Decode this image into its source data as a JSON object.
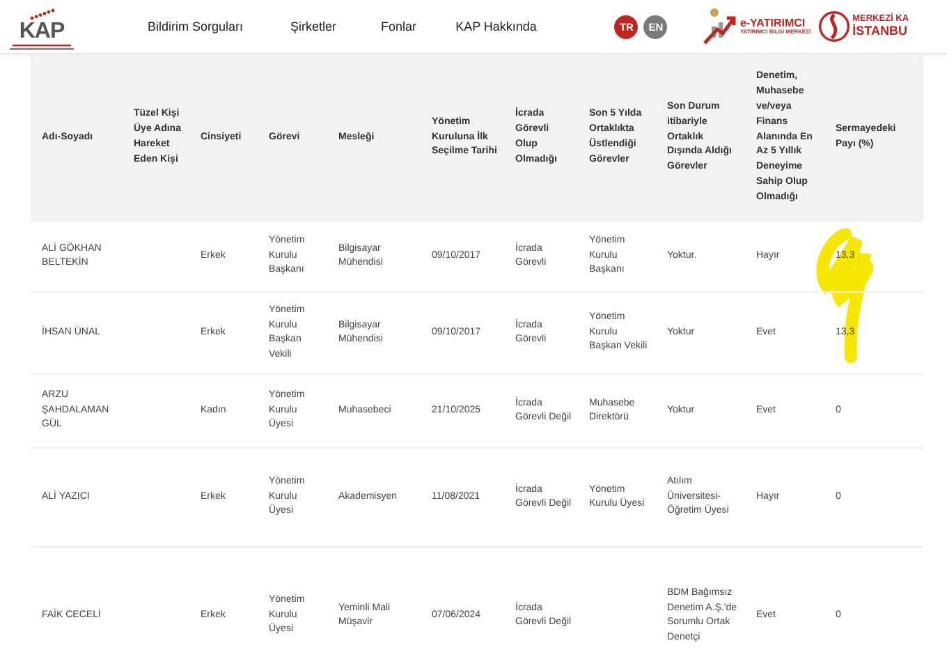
{
  "header": {
    "logo": {
      "text": "KAP"
    },
    "nav": [
      "Bildirim Sorguları",
      "Şirketler",
      "Fonlar",
      "KAP Hakkında"
    ],
    "languages": [
      {
        "label": "TR",
        "selected": true
      },
      {
        "label": "EN",
        "selected": false
      }
    ],
    "partners": [
      {
        "kind": "eyatirimci",
        "title": "e-YATIRIMCI",
        "subtitle": "YATIRIMCI BİLGİ MERKEZİ"
      },
      {
        "kind": "mkk",
        "title": "MERKEZİ KA",
        "subtitle": "İSTANBU"
      }
    ]
  },
  "table": {
    "columns": [
      "Adı-Soyadı",
      "Tüzel Kişi Üye Adına Hareket Eden Kişi",
      "Cinsiyeti",
      "Görevi",
      "Mesleği",
      "Yönetim Kuruluna İlk Seçilme Tarihi",
      "İcrada Görevli Olup Olmadığı",
      "Son 5 Yılda Ortaklıkta Üstlendiği Görevler",
      "Son Durum itibariyle Ortaklık Dışında Aldığı Görevler",
      "Denetim, Muhasebe ve/veya Finans Alanında En Az 5 Yıllık Deneyime Sahip Olup Olmadığı",
      "Sermayedeki Payı (%)"
    ],
    "rows": [
      {
        "name": "ALİ GÖKHAN BELTEKİN",
        "gender": "Erkek",
        "role": "Yönetim Kurulu Başkanı",
        "profession": "Bilgisayar Mühendisi",
        "date": "09/10/2017",
        "executive": "İcrada Görevli",
        "roles_5y": "Yönetim Kurulu Başkanı",
        "outside_roles": "Yoktur.",
        "experience": "Hayır",
        "share": "13,3"
      },
      {
        "name": "İHSAN ÜNAL",
        "gender": "Erkek",
        "role": "Yönetim Kurulu Başkan Vekili",
        "profession": "Bilgisayar Mühendisi",
        "date": "09/10/2017",
        "executive": "İcrada Görevli",
        "roles_5y": "Yönetim Kurulu Başkan Vekili",
        "outside_roles": "Yoktur",
        "experience": "Evet",
        "share": "13,3"
      },
      {
        "name": "ARZU ŞAHDALAMAN GÜL",
        "gender": "Kadın",
        "role": "Yönetim Kurulu Üyesi",
        "profession": "Muhasebeci",
        "date": "21/10/2025",
        "executive": "İcrada Görevli Değil",
        "roles_5y": "Muhasebe Direktörü",
        "outside_roles": "Yoktur",
        "experience": "Evet",
        "share": "0"
      },
      {
        "name": "ALİ YAZICI",
        "gender": "Erkek",
        "role": "Yönetim Kurulu Üyesi",
        "profession": "Akademisyen",
        "date": "11/08/2021",
        "executive": "İcrada Görevli Değil",
        "roles_5y": "Yönetim Kurulu Üyesi",
        "outside_roles": "Atılım Üniversitesi-Öğretim Üyesi",
        "experience": "Hayır",
        "share": "0"
      },
      {
        "name": "FAİK CECELİ",
        "gender": "Erkek",
        "role": "Yönetim Kurulu Üyesi",
        "profession": "Yeminli Mali Müşavir",
        "date": "07/06/2024",
        "executive": "İcrada Görevli Değil",
        "outside_roles": "BDM Bağımsız Denetim A.Ş.'de Sorumlu Ortak Denetçi",
        "experience": "Evet",
        "share": "0"
      }
    ]
  }
}
